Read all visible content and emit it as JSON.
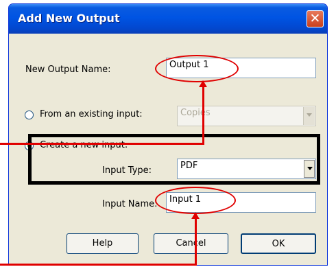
{
  "dialog": {
    "title": "Add New Output",
    "close_icon": "close-icon"
  },
  "output_name": {
    "label": "New Output Name:",
    "value": "Output 1"
  },
  "source_options": [
    {
      "label": "From an existing input:",
      "selected": false
    },
    {
      "label": "Create a new input:",
      "selected": true
    }
  ],
  "existing_input": {
    "value": "Copies",
    "disabled": true
  },
  "input_type": {
    "label": "Input Type:",
    "value": "PDF"
  },
  "input_name": {
    "label": "Input Name:",
    "value": "Input 1"
  },
  "buttons": {
    "help": "Help",
    "cancel": "Cancel",
    "ok": "OK"
  },
  "annotation_color": "#e00000"
}
